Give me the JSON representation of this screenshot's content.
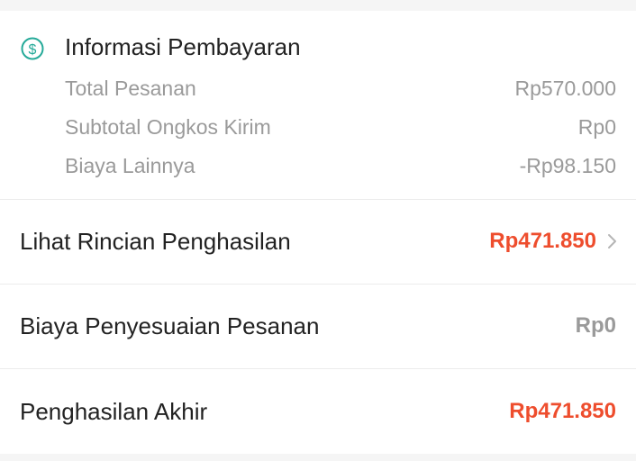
{
  "payment_info": {
    "title": "Informasi Pembayaran",
    "icon": "dollar-circle-icon",
    "lines": [
      {
        "label": "Total Pesanan",
        "value": "Rp570.000"
      },
      {
        "label": "Subtotal Ongkos Kirim",
        "value": "Rp0"
      },
      {
        "label": "Biaya Lainnya",
        "value": "-Rp98.150"
      }
    ]
  },
  "income_details": {
    "label": "Lihat Rincian Penghasilan",
    "value": "Rp471.850"
  },
  "order_adjustment": {
    "label": "Biaya Penyesuaian Pesanan",
    "value": "Rp0"
  },
  "final_income": {
    "label": "Penghasilan Akhir",
    "value": "Rp471.850"
  },
  "colors": {
    "accent": "#ee4d2d",
    "icon_teal": "#26aa99",
    "muted_text": "#9a9a9a"
  }
}
